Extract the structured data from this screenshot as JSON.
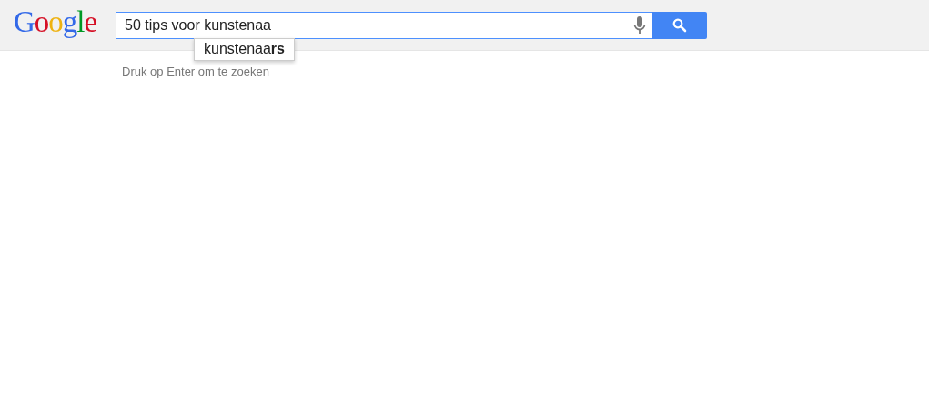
{
  "logo": [
    {
      "letter": "G",
      "color": "#3369e8"
    },
    {
      "letter": "o",
      "color": "#d50f25"
    },
    {
      "letter": "o",
      "color": "#eeb211"
    },
    {
      "letter": "g",
      "color": "#3369e8"
    },
    {
      "letter": "l",
      "color": "#009925"
    },
    {
      "letter": "e",
      "color": "#d50f25"
    }
  ],
  "search": {
    "value": "50 tips voor kunstenaa"
  },
  "suggestion": "kunstenaa**rs**",
  "hint": "Druk op Enter om te zoeken"
}
